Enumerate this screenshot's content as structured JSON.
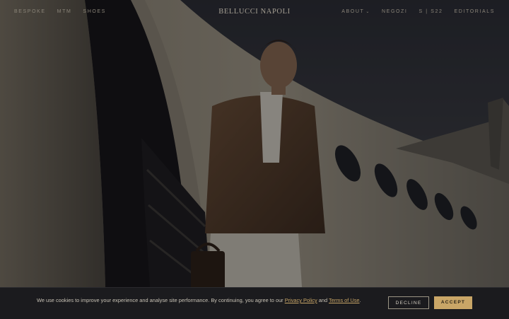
{
  "nav": {
    "left": [
      {
        "label": "BESPOKE"
      },
      {
        "label": "MTM"
      },
      {
        "label": "SHOES"
      }
    ],
    "brand": "BELLUCCI NAPOLI",
    "right": [
      {
        "label": "ABOUT",
        "has_dropdown": true
      },
      {
        "label": "NEGOZI"
      },
      {
        "label": "S | S22"
      },
      {
        "label": "EDITORIALS"
      }
    ],
    "dropdown_glyph": "⌄"
  },
  "hero": {
    "alt": "Man in tan linen jacket stepping off a private jet",
    "icon": "hero-photo"
  },
  "cookie": {
    "text_before": "We use cookies to improve your experience and analyse site performance. By continuing, you agree to our ",
    "privacy_link": "Privacy Policy",
    "text_middle": " and ",
    "terms_link": "Terms of Use",
    "text_after": ".",
    "decline": "DECLINE",
    "accept": "ACCEPT"
  },
  "colors": {
    "accent": "#c9a667",
    "nav_text": "#8a8478",
    "cookie_bg": "#1b1b1e"
  }
}
